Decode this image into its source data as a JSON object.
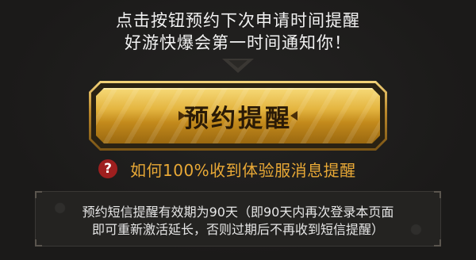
{
  "intro": {
    "line1": "点击按钮预约下次申请时间提醒",
    "line2": "好游快爆会第一时间通知你！"
  },
  "reserve_button": {
    "label": "预约提醒"
  },
  "help": {
    "icon": "question-circle-icon",
    "icon_glyph": "?",
    "link_text": "如何100%收到体验服消息提醒"
  },
  "notice": {
    "line1": "预约短信提醒有效期为90天（即90天内再次登录本页面",
    "line2": "即可重新激活延长，否则过期后不再收到短信提醒）"
  },
  "colors": {
    "background": "#1b1a19",
    "gold": "#e4b540",
    "accent_orange": "#e9a936",
    "help_red": "#9e1f1f"
  }
}
